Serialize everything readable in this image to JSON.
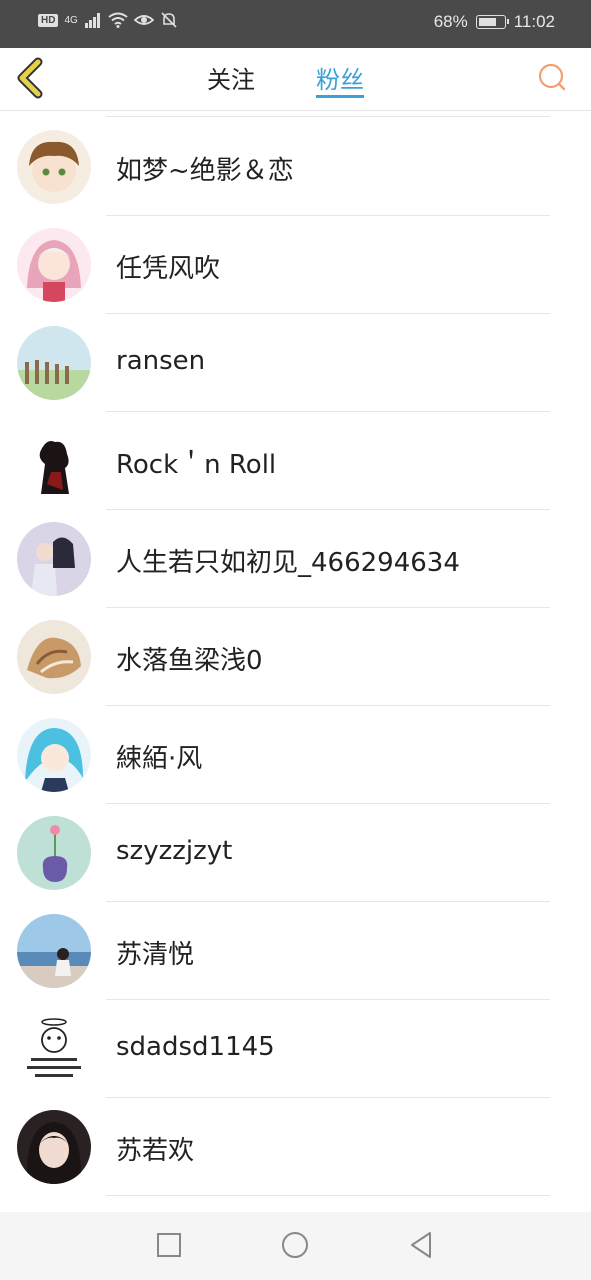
{
  "status_bar": {
    "hd": "HD",
    "signal": "4G",
    "battery": "68%",
    "time": "11:02"
  },
  "header": {
    "tabs": [
      {
        "label": "关注",
        "active": false
      },
      {
        "label": "粉丝",
        "active": true
      }
    ],
    "accent_color": "#3aa0d8"
  },
  "fans": [
    {
      "name": "如梦~绝影＆恋",
      "avatar": "anime-boy-avatar"
    },
    {
      "name": "任凭风吹",
      "avatar": "anime-girl-pink-avatar"
    },
    {
      "name": "ransen",
      "avatar": "fence-landscape-avatar"
    },
    {
      "name": "Rock＇n Roll",
      "avatar": "dark-figure-avatar"
    },
    {
      "name": "人生若只如初见_466294634",
      "avatar": "couple-photo-avatar"
    },
    {
      "name": "水落鱼梁浅0",
      "avatar": "seashell-avatar"
    },
    {
      "name": "綀絔·风",
      "avatar": "anime-blue-hair-avatar"
    },
    {
      "name": "szyzzjzyt",
      "avatar": "flower-vase-avatar"
    },
    {
      "name": "苏清悦",
      "avatar": "seaside-girl-avatar"
    },
    {
      "name": "sdadsd1145",
      "avatar": "cartoon-meme-avatar"
    },
    {
      "name": "苏若欢",
      "avatar": "portrait-girl-avatar"
    }
  ]
}
